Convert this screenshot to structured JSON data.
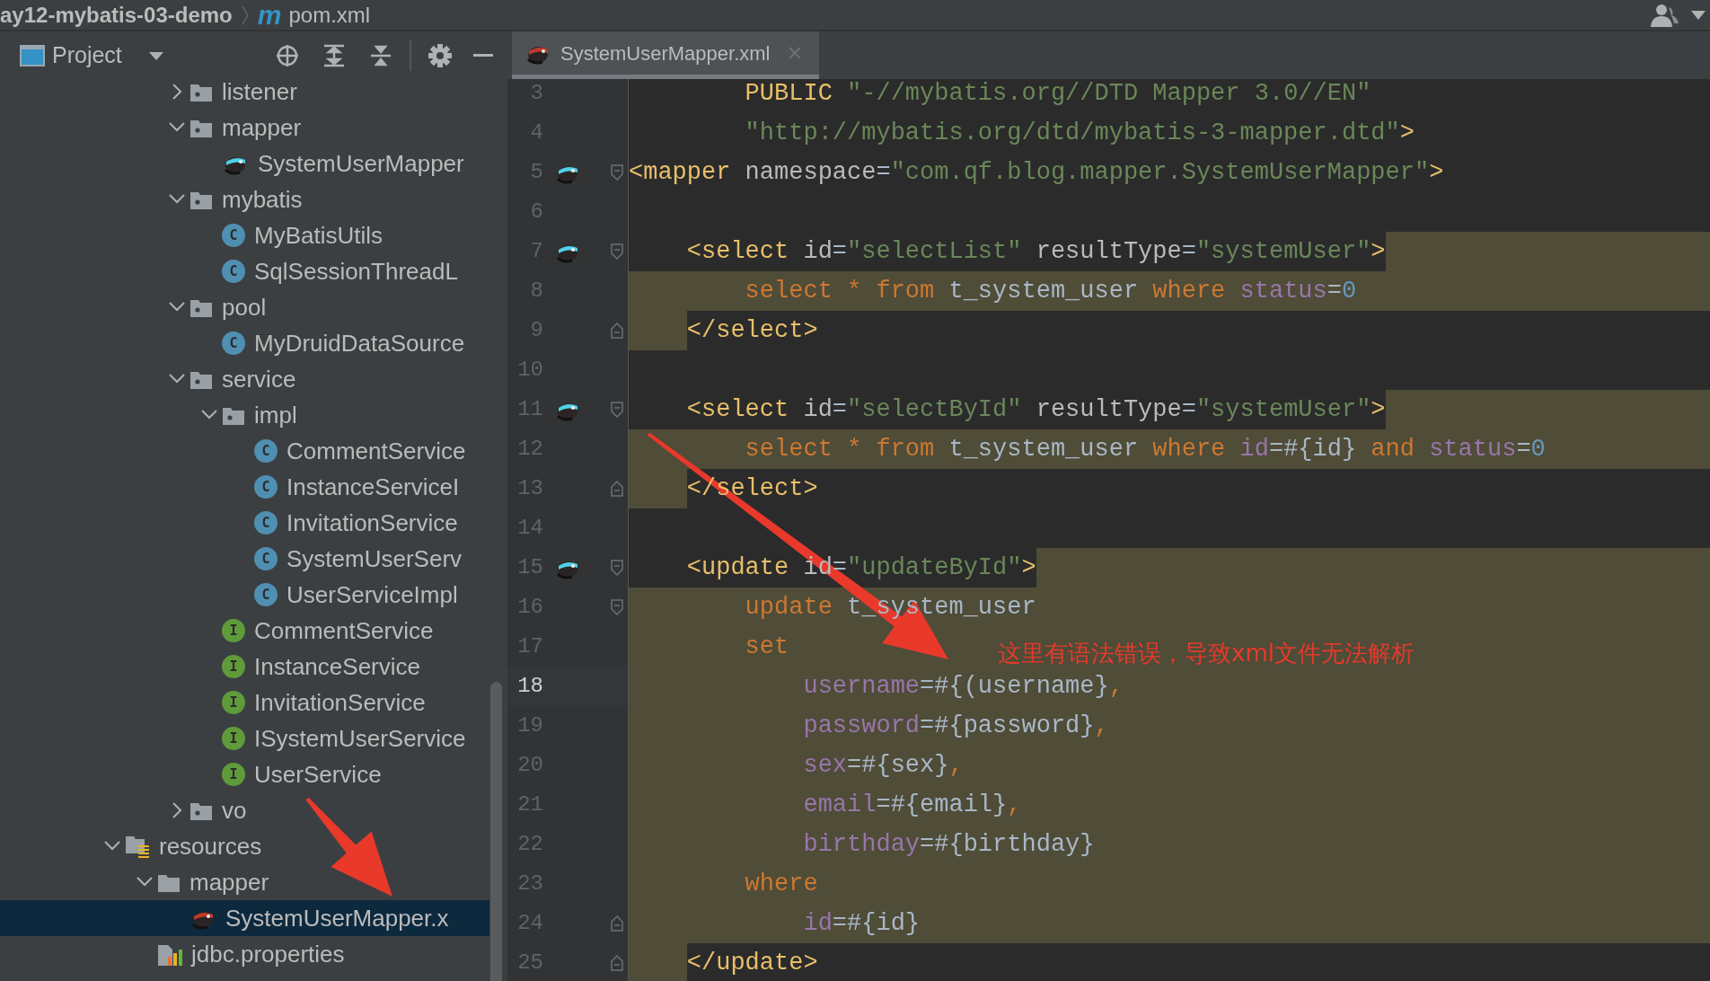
{
  "breadcrumb": {
    "project": "ay12-mybatis-03-demo",
    "file_icon_glyph": "m",
    "file": "pom.xml"
  },
  "tool_window": {
    "title": "Project"
  },
  "tree": {
    "partial_branch": [
      {
        "label": "listener",
        "kind": "package",
        "expanded": false,
        "selected": false
      },
      {
        "label": "mapper",
        "kind": "package",
        "expanded": true,
        "selected": false,
        "children": [
          {
            "label": "SystemUserMapper",
            "kind": "mapper_java",
            "selected": false
          }
        ]
      },
      {
        "label": "mybatis",
        "kind": "package",
        "expanded": true,
        "selected": false,
        "children": [
          {
            "label": "MyBatisUtils",
            "kind": "class",
            "badge": "C",
            "selected": false
          },
          {
            "label": "SqlSessionThreadL",
            "kind": "class",
            "badge": "C",
            "selected": false
          }
        ]
      },
      {
        "label": "pool",
        "kind": "package",
        "expanded": true,
        "selected": false,
        "children": [
          {
            "label": "MyDruidDataSource",
            "kind": "class",
            "badge": "C",
            "selected": false
          }
        ]
      },
      {
        "label": "service",
        "kind": "package",
        "expanded": true,
        "selected": false,
        "children": [
          {
            "label": "impl",
            "kind": "package",
            "expanded": true,
            "selected": false,
            "children": [
              {
                "label": "CommentService",
                "kind": "class",
                "badge": "C",
                "selected": false
              },
              {
                "label": "InstanceServiceI",
                "kind": "class",
                "badge": "C",
                "selected": false
              },
              {
                "label": "InvitationService",
                "kind": "class",
                "badge": "C",
                "selected": false
              },
              {
                "label": "SystemUserServ",
                "kind": "class",
                "badge": "C",
                "selected": false
              },
              {
                "label": "UserServiceImpl",
                "kind": "class",
                "badge": "C",
                "selected": false
              }
            ]
          },
          {
            "label": "CommentService",
            "kind": "interface",
            "badge": "I",
            "selected": false
          },
          {
            "label": "InstanceService",
            "kind": "interface",
            "badge": "I",
            "selected": false
          },
          {
            "label": "InvitationService",
            "kind": "interface",
            "badge": "I",
            "selected": false
          },
          {
            "label": "ISystemUserService",
            "kind": "interface",
            "badge": "I",
            "selected": false
          },
          {
            "label": "UserService",
            "kind": "interface",
            "badge": "I",
            "selected": false
          }
        ]
      },
      {
        "label": "vo",
        "kind": "package",
        "expanded": false,
        "selected": false
      }
    ],
    "items": [
      {
        "label": "resources",
        "kind": "resources",
        "expanded": true,
        "selected": false,
        "children": [
          {
            "label": "mapper",
            "kind": "folder",
            "expanded": true,
            "selected": false,
            "children": [
              {
                "label": "SystemUserMapper.x",
                "kind": "mapper_xml",
                "selected": true
              }
            ]
          },
          {
            "label": "jdbc.properties",
            "kind": "properties",
            "selected": false
          }
        ]
      }
    ]
  },
  "tabs": [
    {
      "label": "SystemUserMapper.xml",
      "kind": "mapper_xml",
      "selected": true
    }
  ],
  "editor": {
    "lines": [
      {
        "number": "3",
        "kind": "plain",
        "mapped": false,
        "current": false,
        "fold_start": false,
        "fold_end": false,
        "tokens": [
          {
            "kind": "tag",
            "text": "        PUBLIC "
          },
          {
            "kind": "string",
            "text": "\"-//mybatis.org//DTD Mapper 3.0//EN\""
          }
        ]
      },
      {
        "number": "4",
        "kind": "plain",
        "mapped": false,
        "current": false,
        "fold_start": false,
        "fold_end": false,
        "tokens": [
          {
            "kind": "string",
            "text": "        \"http://mybatis.org/dtd/mybatis-3-mapper.dtd\""
          },
          {
            "kind": "tag",
            "text": ">"
          }
        ]
      },
      {
        "number": "5",
        "kind": "plain",
        "mapped": true,
        "current": false,
        "fold_start": true,
        "fold_end": false,
        "tokens": [
          {
            "kind": "tag",
            "text": "<mapper"
          },
          {
            "kind": "attr",
            "text": " namespace"
          },
          {
            "kind": "text",
            "text": "="
          },
          {
            "kind": "string",
            "text": "\"com.qf.blog.mapper.SystemUserMapper\""
          },
          {
            "kind": "tag",
            "text": ">"
          }
        ]
      },
      {
        "number": "6",
        "kind": "plain",
        "mapped": false,
        "current": false,
        "fold_start": false,
        "fold_end": false
      },
      {
        "number": "7",
        "kind": "highlighted_tail",
        "mapped": true,
        "current": false,
        "fold_start": true,
        "fold_end": false,
        "tokens": [
          {
            "kind": "tag",
            "text": "    <select"
          },
          {
            "kind": "attr",
            "text": " id"
          },
          {
            "kind": "text",
            "text": "="
          },
          {
            "kind": "string",
            "text": "\"selectList\""
          },
          {
            "kind": "attr",
            "text": " resultType"
          },
          {
            "kind": "text",
            "text": "="
          },
          {
            "kind": "string",
            "text": "\"systemUser\""
          },
          {
            "kind": "tag",
            "text": ">"
          }
        ]
      },
      {
        "number": "8",
        "kind": "highlighted",
        "mapped": false,
        "current": false,
        "fold_start": false,
        "fold_end": false,
        "tokens": [
          {
            "kind": "keyword",
            "text": "        select * from "
          },
          {
            "kind": "text",
            "text": "t_system_user "
          },
          {
            "kind": "keyword",
            "text": "where "
          },
          {
            "kind": "param",
            "text": "status"
          },
          {
            "kind": "text",
            "text": "="
          },
          {
            "kind": "number",
            "text": "0"
          }
        ]
      },
      {
        "number": "9",
        "kind": "highlighted_indent",
        "mapped": false,
        "current": false,
        "fold_start": false,
        "fold_end": true,
        "tokens": [
          {
            "kind": "tag",
            "text": "    </select>"
          }
        ]
      },
      {
        "number": "10",
        "kind": "plain",
        "mapped": false,
        "current": false,
        "fold_start": false,
        "fold_end": false
      },
      {
        "number": "11",
        "kind": "highlighted_tail",
        "mapped": true,
        "current": false,
        "fold_start": true,
        "fold_end": false,
        "tokens": [
          {
            "kind": "tag",
            "text": "    <select"
          },
          {
            "kind": "attr",
            "text": " id"
          },
          {
            "kind": "text",
            "text": "="
          },
          {
            "kind": "string",
            "text": "\"selectById\""
          },
          {
            "kind": "attr",
            "text": " resultType"
          },
          {
            "kind": "text",
            "text": "="
          },
          {
            "kind": "string",
            "text": "\"systemUser\""
          },
          {
            "kind": "tag",
            "text": ">"
          }
        ]
      },
      {
        "number": "12",
        "kind": "highlighted",
        "mapped": false,
        "current": false,
        "fold_start": false,
        "fold_end": false,
        "tokens": [
          {
            "kind": "keyword",
            "text": "        select * from "
          },
          {
            "kind": "text",
            "text": "t_system_user "
          },
          {
            "kind": "keyword",
            "text": "where "
          },
          {
            "kind": "param",
            "text": "id"
          },
          {
            "kind": "text",
            "text": "=#{id} "
          },
          {
            "kind": "keyword",
            "text": "and "
          },
          {
            "kind": "param",
            "text": "status"
          },
          {
            "kind": "text",
            "text": "="
          },
          {
            "kind": "number",
            "text": "0"
          }
        ]
      },
      {
        "number": "13",
        "kind": "highlighted_indent",
        "mapped": false,
        "current": false,
        "fold_start": false,
        "fold_end": true,
        "tokens": [
          {
            "kind": "tag",
            "text": "    </select>"
          }
        ]
      },
      {
        "number": "14",
        "kind": "plain",
        "mapped": false,
        "current": false,
        "fold_start": false,
        "fold_end": false
      },
      {
        "number": "15",
        "kind": "highlighted_tail",
        "mapped": true,
        "current": false,
        "fold_start": true,
        "fold_end": false,
        "tokens": [
          {
            "kind": "tag",
            "text": "    <update"
          },
          {
            "kind": "attr",
            "text": " id"
          },
          {
            "kind": "text",
            "text": "="
          },
          {
            "kind": "string",
            "text": "\"updateById\""
          },
          {
            "kind": "tag",
            "text": ">"
          }
        ]
      },
      {
        "number": "16",
        "kind": "highlighted",
        "mapped": false,
        "current": false,
        "fold_start": true,
        "fold_end": false,
        "tokens": [
          {
            "kind": "keyword",
            "text": "        update "
          },
          {
            "kind": "text",
            "text": "t_system_user"
          }
        ]
      },
      {
        "number": "17",
        "kind": "highlighted",
        "mapped": false,
        "current": false,
        "fold_start": false,
        "fold_end": false,
        "tokens": [
          {
            "kind": "keyword",
            "text": "        set"
          }
        ]
      },
      {
        "number": "18",
        "kind": "highlighted",
        "mapped": false,
        "current": true,
        "fold_start": false,
        "fold_end": false,
        "tokens": [
          {
            "kind": "param",
            "text": "            username"
          },
          {
            "kind": "text",
            "text": "=#{(username}"
          },
          {
            "kind": "keyword",
            "text": ","
          }
        ]
      },
      {
        "number": "19",
        "kind": "highlighted",
        "mapped": false,
        "current": false,
        "fold_start": false,
        "fold_end": false,
        "tokens": [
          {
            "kind": "param",
            "text": "            password"
          },
          {
            "kind": "text",
            "text": "=#{password}"
          },
          {
            "kind": "keyword",
            "text": ","
          }
        ]
      },
      {
        "number": "20",
        "kind": "highlighted",
        "mapped": false,
        "current": false,
        "fold_start": false,
        "fold_end": false,
        "tokens": [
          {
            "kind": "param",
            "text": "            sex"
          },
          {
            "kind": "text",
            "text": "=#{sex}"
          },
          {
            "kind": "keyword",
            "text": ","
          }
        ]
      },
      {
        "number": "21",
        "kind": "highlighted",
        "mapped": false,
        "current": false,
        "fold_start": false,
        "fold_end": false,
        "tokens": [
          {
            "kind": "param",
            "text": "            email"
          },
          {
            "kind": "text",
            "text": "=#{email}"
          },
          {
            "kind": "keyword",
            "text": ","
          }
        ]
      },
      {
        "number": "22",
        "kind": "highlighted",
        "mapped": false,
        "current": false,
        "fold_start": false,
        "fold_end": false,
        "tokens": [
          {
            "kind": "param",
            "text": "            birthday"
          },
          {
            "kind": "text",
            "text": "=#{birthday}"
          }
        ]
      },
      {
        "number": "23",
        "kind": "highlighted",
        "mapped": false,
        "current": false,
        "fold_start": false,
        "fold_end": false,
        "tokens": [
          {
            "kind": "keyword",
            "text": "        where"
          }
        ]
      },
      {
        "number": "24",
        "kind": "highlighted",
        "mapped": false,
        "current": false,
        "fold_start": false,
        "fold_end": true,
        "tokens": [
          {
            "kind": "param",
            "text": "            id"
          },
          {
            "kind": "text",
            "text": "=#{id}"
          }
        ]
      },
      {
        "number": "25",
        "kind": "highlighted_indent",
        "mapped": false,
        "current": false,
        "fold_start": false,
        "fold_end": true,
        "tokens": [
          {
            "kind": "tag",
            "text": "    </update>"
          }
        ]
      }
    ]
  },
  "annotation": {
    "text": "这里有语法错误，导致xml文件无法解析"
  }
}
